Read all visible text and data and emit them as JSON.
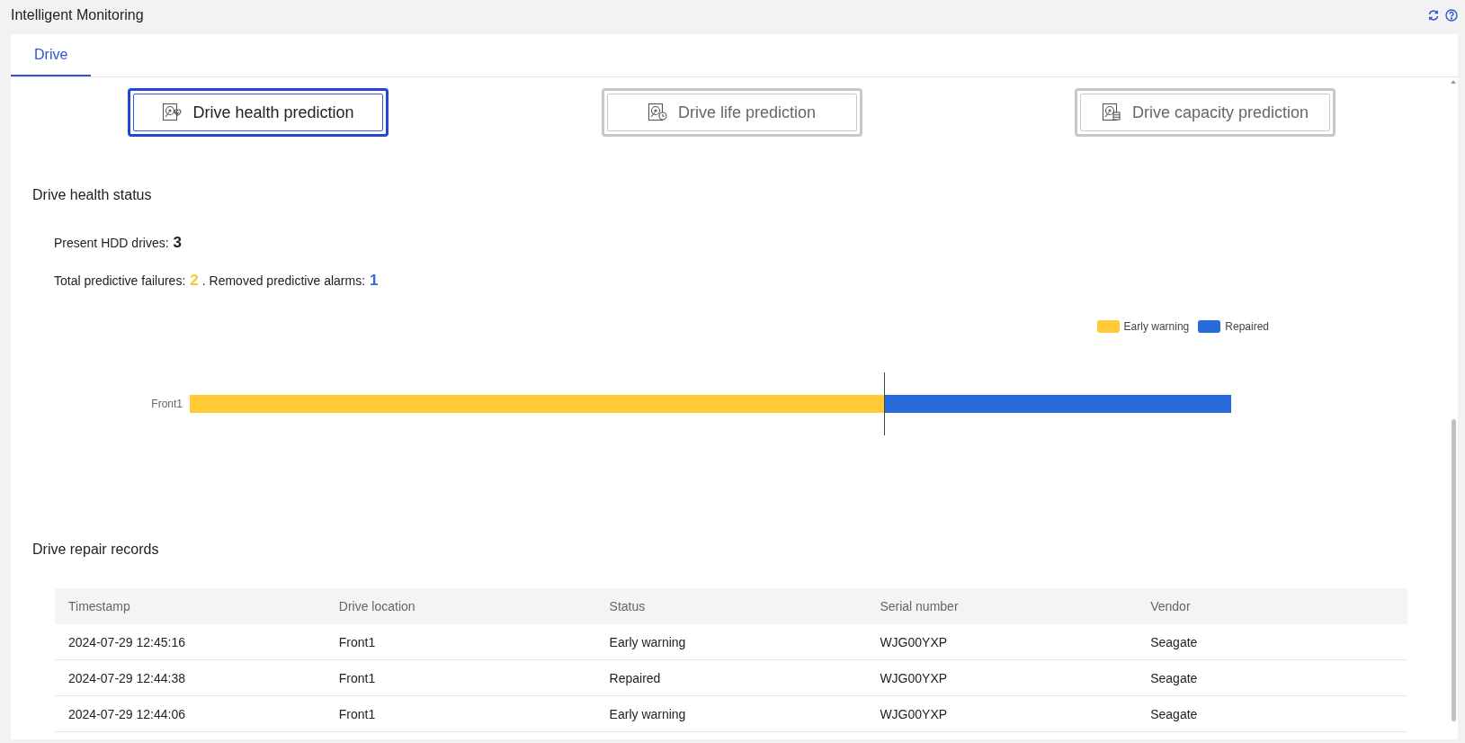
{
  "window": {
    "title": "Intelligent Monitoring"
  },
  "tabs": [
    {
      "label": "Drive",
      "selected": true
    }
  ],
  "prediction_buttons": [
    {
      "label": "Drive health prediction",
      "kind": "health",
      "selected": true
    },
    {
      "label": "Drive life prediction",
      "kind": "life",
      "selected": false
    },
    {
      "label": "Drive capacity prediction",
      "kind": "capacity",
      "selected": false
    }
  ],
  "health_status": {
    "title": "Drive health status",
    "lines": [
      [
        {
          "label": "Present HDD drives:",
          "value": "3",
          "color": "#222222"
        }
      ],
      [
        {
          "label": "Total predictive failures:",
          "value": "2",
          "color": "#fdc62f"
        },
        {
          "label": ". Removed predictive alarms:",
          "value": "1",
          "color": "#2f6bdd"
        }
      ]
    ],
    "chart": {
      "legend": [
        {
          "label": "Early warning",
          "color": "#ffca35"
        },
        {
          "label": "Repaired",
          "color": "#276ad9"
        }
      ],
      "rows": [
        {
          "label": "Front1"
        }
      ]
    }
  },
  "repair_records": {
    "title": "Drive repair records",
    "columns": [
      "Timestamp",
      "Drive location",
      "Status",
      "Serial number",
      "Vendor"
    ],
    "rows": [
      [
        "2024-07-29 12:45:16",
        "Front1",
        "Early warning",
        "WJG00YXP",
        "Seagate"
      ],
      [
        "2024-07-29 12:44:38",
        "Front1",
        "Repaired",
        "WJG00YXP",
        "Seagate"
      ],
      [
        "2024-07-29 12:44:06",
        "Front1",
        "Early warning",
        "WJG00YXP",
        "Seagate"
      ]
    ]
  }
}
